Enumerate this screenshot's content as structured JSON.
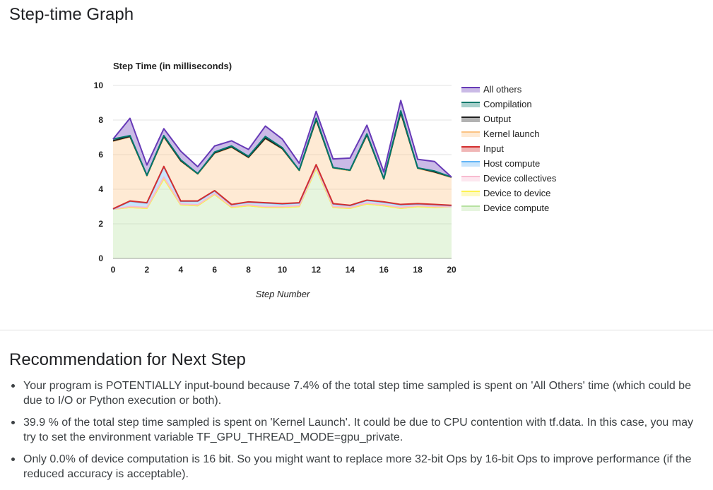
{
  "header": {
    "title": "Step-time Graph"
  },
  "chart_data": {
    "type": "area",
    "stacked": true,
    "title": "Step Time (in milliseconds)",
    "xlabel": "Step Number",
    "ylabel": "",
    "xlim": [
      0,
      20
    ],
    "ylim": [
      0,
      10
    ],
    "x_ticks": [
      0,
      2,
      4,
      6,
      8,
      10,
      12,
      14,
      16,
      18,
      20
    ],
    "y_ticks": [
      0,
      2,
      4,
      6,
      8,
      10
    ],
    "grid": true,
    "legend_position": "right",
    "x": [
      0,
      1,
      2,
      3,
      4,
      5,
      6,
      7,
      8,
      9,
      10,
      11,
      12,
      13,
      14,
      15,
      16,
      17,
      18,
      19,
      20
    ],
    "series": [
      {
        "name": "Device compute",
        "color": "#b7e1a1",
        "values": [
          2.85,
          2.95,
          2.9,
          4.6,
          3.1,
          3.05,
          3.7,
          2.95,
          3.05,
          2.95,
          2.95,
          3.0,
          5.2,
          2.95,
          2.9,
          3.15,
          3.05,
          2.9,
          3.0,
          2.95,
          3.0
        ]
      },
      {
        "name": "Device to device",
        "color": "#fdf251",
        "values": [
          0,
          0,
          0,
          0,
          0,
          0,
          0,
          0,
          0,
          0,
          0,
          0,
          0,
          0,
          0,
          0,
          0,
          0,
          0,
          0,
          0
        ]
      },
      {
        "name": "Device collectives",
        "color": "#f8bbd0",
        "values": [
          0.0,
          0.05,
          0.05,
          0.1,
          0.05,
          0.05,
          0.05,
          0.05,
          0.05,
          0.05,
          0.05,
          0.05,
          0.1,
          0.05,
          0.05,
          0.05,
          0.05,
          0.05,
          0.05,
          0.05,
          0.0
        ]
      },
      {
        "name": "Host compute",
        "color": "#64b5f6",
        "values": [
          0.0,
          0.3,
          0.25,
          0.6,
          0.15,
          0.2,
          0.15,
          0.1,
          0.15,
          0.2,
          0.15,
          0.15,
          0.1,
          0.15,
          0.1,
          0.15,
          0.15,
          0.15,
          0.1,
          0.1,
          0.05
        ]
      },
      {
        "name": "Input",
        "color": "#d32f2f",
        "values": [
          0.02,
          0.02,
          0.02,
          0.02,
          0.02,
          0.02,
          0.02,
          0.02,
          0.02,
          0.02,
          0.02,
          0.02,
          0.02,
          0.02,
          0.02,
          0.02,
          0.02,
          0.02,
          0.02,
          0.02,
          0.02
        ]
      },
      {
        "name": "Kernel launch",
        "color": "#fbc384",
        "values": [
          3.9,
          3.7,
          1.55,
          1.7,
          2.3,
          1.55,
          2.15,
          3.3,
          2.55,
          3.7,
          3.15,
          1.85,
          2.58,
          2.05,
          2.0,
          3.75,
          1.3,
          5.28,
          2.03,
          1.85,
          1.6
        ]
      },
      {
        "name": "Output",
        "color": "#212121",
        "values": [
          0.03,
          0.03,
          0.03,
          0.03,
          0.03,
          0.03,
          0.03,
          0.03,
          0.03,
          0.03,
          0.03,
          0.03,
          0.03,
          0.03,
          0.03,
          0.03,
          0.03,
          0.03,
          0.03,
          0.03,
          0.03
        ]
      },
      {
        "name": "Compilation",
        "color": "#00796b",
        "values": [
          0.1,
          0.05,
          0.0,
          0.05,
          0.05,
          0.0,
          0.05,
          0.05,
          0.05,
          0.1,
          0.05,
          0.0,
          0.07,
          0.0,
          0.0,
          0.05,
          0.0,
          0.1,
          0.0,
          0.05,
          0.0
        ]
      },
      {
        "name": "All others",
        "color": "#673ab7",
        "values": [
          0.0,
          1.0,
          0.6,
          0.4,
          0.5,
          0.4,
          0.35,
          0.3,
          0.4,
          0.6,
          0.5,
          0.4,
          0.4,
          0.5,
          0.7,
          0.5,
          0.4,
          0.6,
          0.5,
          0.55,
          0.0
        ]
      }
    ]
  },
  "recommendation": {
    "title": "Recommendation for Next Step",
    "items": [
      "Your program is POTENTIALLY input-bound because 7.4% of the total step time sampled is spent on 'All Others' time (which could be due to I/O or Python execution or both).",
      "39.9 % of the total step time sampled is spent on 'Kernel Launch'. It could be due to CPU contention with tf.data. In this case, you may try to set the environment variable TF_GPU_THREAD_MODE=gpu_private.",
      "Only 0.0% of device computation is 16 bit. So you might want to replace more 32-bit Ops by 16-bit Ops to improve performance (if the reduced accuracy is acceptable)."
    ]
  }
}
